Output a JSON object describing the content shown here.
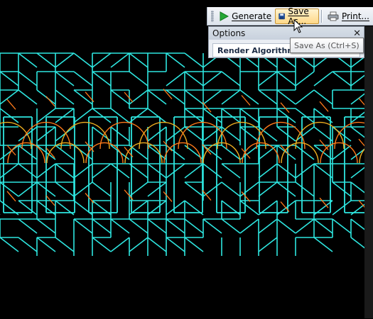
{
  "colors": {
    "background": "#000000",
    "cyan_lines": "#2ee6e0",
    "orange_lines": "#ff7a1a",
    "gold_lines": "#f0b020"
  },
  "toolbar": {
    "generate_label": "Generate",
    "generate_icon": "play-icon",
    "save_as_label": "Save As...",
    "save_as_icon": "floppy-disk-icon",
    "print_label": "Print...",
    "print_icon": "printer-icon"
  },
  "options_panel": {
    "title": "Options",
    "section_title": "Render Algorithm"
  },
  "tooltip": {
    "text": "Save As (Ctrl+S)"
  }
}
